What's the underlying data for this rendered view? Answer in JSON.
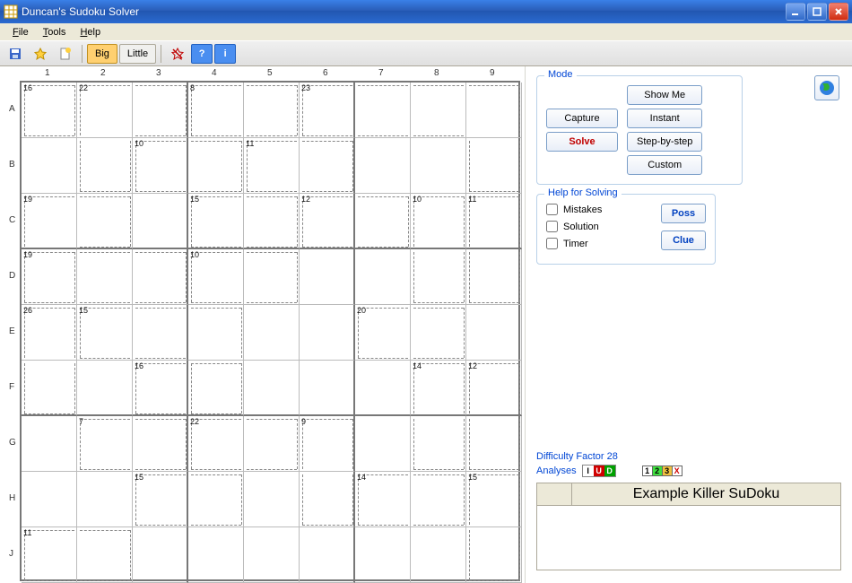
{
  "window": {
    "title": "Duncan's Sudoku Solver"
  },
  "menu": {
    "file": "File",
    "tools": "Tools",
    "help": "Help"
  },
  "toolbar": {
    "big": "Big",
    "little": "Little"
  },
  "grid": {
    "cols": [
      "1",
      "2",
      "3",
      "4",
      "5",
      "6",
      "7",
      "8",
      "9"
    ],
    "rows": [
      "A",
      "B",
      "C",
      "D",
      "E",
      "F",
      "G",
      "H",
      "J"
    ],
    "cages": [
      {
        "sum": "16",
        "cells": [
          [
            0,
            0
          ]
        ]
      },
      {
        "sum": "22",
        "cells": [
          [
            0,
            1
          ],
          [
            0,
            2
          ],
          [
            1,
            1
          ]
        ]
      },
      {
        "sum": "8",
        "cells": [
          [
            0,
            3
          ],
          [
            0,
            4
          ]
        ]
      },
      {
        "sum": "23",
        "cells": [
          [
            0,
            5
          ],
          [
            0,
            6
          ],
          [
            0,
            7
          ],
          [
            0,
            8
          ],
          [
            1,
            8
          ]
        ]
      },
      {
        "sum": "10",
        "cells": [
          [
            1,
            2
          ],
          [
            1,
            3
          ]
        ]
      },
      {
        "sum": "11",
        "cells": [
          [
            1,
            4
          ],
          [
            1,
            5
          ]
        ]
      },
      {
        "sum": "19",
        "cells": [
          [
            2,
            0
          ],
          [
            2,
            1
          ],
          [
            3,
            0
          ]
        ]
      },
      {
        "sum": "15",
        "cells": [
          [
            2,
            3
          ],
          [
            2,
            4
          ]
        ]
      },
      {
        "sum": "12",
        "cells": [
          [
            2,
            5
          ],
          [
            2,
            6
          ]
        ]
      },
      {
        "sum": "10",
        "cells": [
          [
            2,
            7
          ],
          [
            3,
            7
          ]
        ]
      },
      {
        "sum": "11",
        "cells": [
          [
            2,
            8
          ],
          [
            3,
            8
          ]
        ]
      },
      {
        "sum": "19",
        "cells": [
          [
            3,
            0
          ],
          [
            3,
            1
          ],
          [
            3,
            2
          ]
        ]
      },
      {
        "sum": "10",
        "cells": [
          [
            3,
            3
          ],
          [
            3,
            4
          ]
        ]
      },
      {
        "sum": "26",
        "cells": [
          [
            4,
            0
          ],
          [
            5,
            0
          ]
        ]
      },
      {
        "sum": "15",
        "cells": [
          [
            4,
            1
          ],
          [
            4,
            2
          ],
          [
            4,
            3
          ],
          [
            5,
            3
          ]
        ]
      },
      {
        "sum": "20",
        "cells": [
          [
            4,
            6
          ],
          [
            4,
            7
          ]
        ]
      },
      {
        "sum": "16",
        "cells": [
          [
            5,
            2
          ],
          [
            5,
            3
          ]
        ]
      },
      {
        "sum": "14",
        "cells": [
          [
            5,
            7
          ],
          [
            6,
            7
          ]
        ]
      },
      {
        "sum": "12",
        "cells": [
          [
            5,
            8
          ],
          [
            6,
            8
          ]
        ]
      },
      {
        "sum": "7",
        "cells": [
          [
            6,
            1
          ],
          [
            6,
            2
          ]
        ]
      },
      {
        "sum": "22",
        "cells": [
          [
            6,
            3
          ],
          [
            6,
            4
          ]
        ]
      },
      {
        "sum": "9",
        "cells": [
          [
            6,
            5
          ],
          [
            7,
            5
          ]
        ]
      },
      {
        "sum": "15",
        "cells": [
          [
            7,
            2
          ],
          [
            7,
            3
          ]
        ]
      },
      {
        "sum": "14",
        "cells": [
          [
            7,
            6
          ],
          [
            7,
            7
          ]
        ]
      },
      {
        "sum": "15",
        "cells": [
          [
            7,
            8
          ],
          [
            8,
            8
          ]
        ]
      },
      {
        "sum": "11",
        "cells": [
          [
            8,
            0
          ],
          [
            8,
            1
          ]
        ]
      }
    ]
  },
  "mode": {
    "legend": "Mode",
    "capture": "Capture",
    "solve": "Solve",
    "showme": "Show Me",
    "instant": "Instant",
    "stepbystep": "Step-by-step",
    "custom": "Custom"
  },
  "helpSolve": {
    "legend": "Help for Solving",
    "mistakes": "Mistakes",
    "solution": "Solution",
    "timer": "Timer",
    "poss": "Poss",
    "clue": "Clue"
  },
  "footer": {
    "difficulty": "Difficulty Factor 28",
    "analyses": "Analyses",
    "exampleTitle": "Example Killer SuDoku",
    "boxes1": [
      "I",
      "U",
      "D"
    ],
    "boxes1_colors": [
      "#ffffff",
      "#d00000",
      "#00a000"
    ],
    "boxes2": [
      "1",
      "2",
      "3",
      "X"
    ],
    "boxes2_colors": [
      "#ffffff",
      "#40e040",
      "#f0c040",
      "#ffffff"
    ]
  }
}
